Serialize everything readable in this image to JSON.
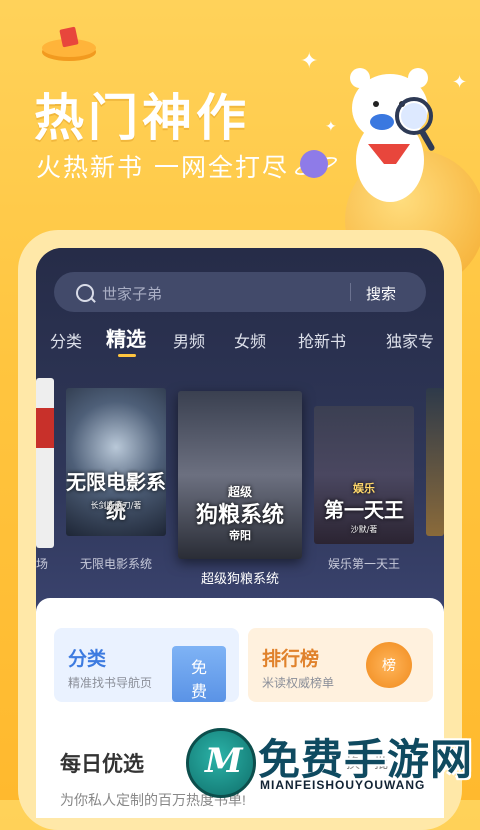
{
  "promo": {
    "title": "热门神作",
    "subtitle": "火热新书 一网全打尽"
  },
  "search": {
    "placeholder": "世家子弟",
    "button_label": "搜索"
  },
  "tabs": [
    {
      "label": "分类",
      "active": false
    },
    {
      "label": "精选",
      "active": true
    },
    {
      "label": "男频",
      "active": false
    },
    {
      "label": "女频",
      "active": false
    },
    {
      "label": "抢新书",
      "active": false
    },
    {
      "label": "独家专",
      "active": false
    }
  ],
  "books": [
    {
      "name": "无限电影系统",
      "cover_text": "无限电影系统",
      "cover_author": "长剑断雁刀/著"
    },
    {
      "name": "超级狗粮系统",
      "cover_text": "狗粮系统",
      "cover_prefix": "超级",
      "cover_author": "帝阳"
    },
    {
      "name": "娱乐第一天王",
      "cover_text": "第一天王",
      "cover_prefix": "娱乐",
      "cover_author": "沙默/著"
    }
  ],
  "left_partial_book_fragment": "场",
  "entries": {
    "category": {
      "title": "分类",
      "subtitle": "精准找书导航页",
      "badge": "免费"
    },
    "ranking": {
      "title": "排行榜",
      "subtitle": "米读权威榜单",
      "badge": "榜"
    }
  },
  "daily": {
    "title": "每日优选",
    "more": "换一批",
    "description": "为你私人定制的百万热度书单!"
  },
  "watermark": {
    "text": "免费手游网",
    "url": "MIANFEISHOUYOUWANG"
  },
  "colors": {
    "background": "#FFC53F",
    "screen": "#2A3150",
    "accent": "#FFC53F",
    "category_card": "#EAF2FF",
    "ranking_card": "#FFF1DE"
  }
}
